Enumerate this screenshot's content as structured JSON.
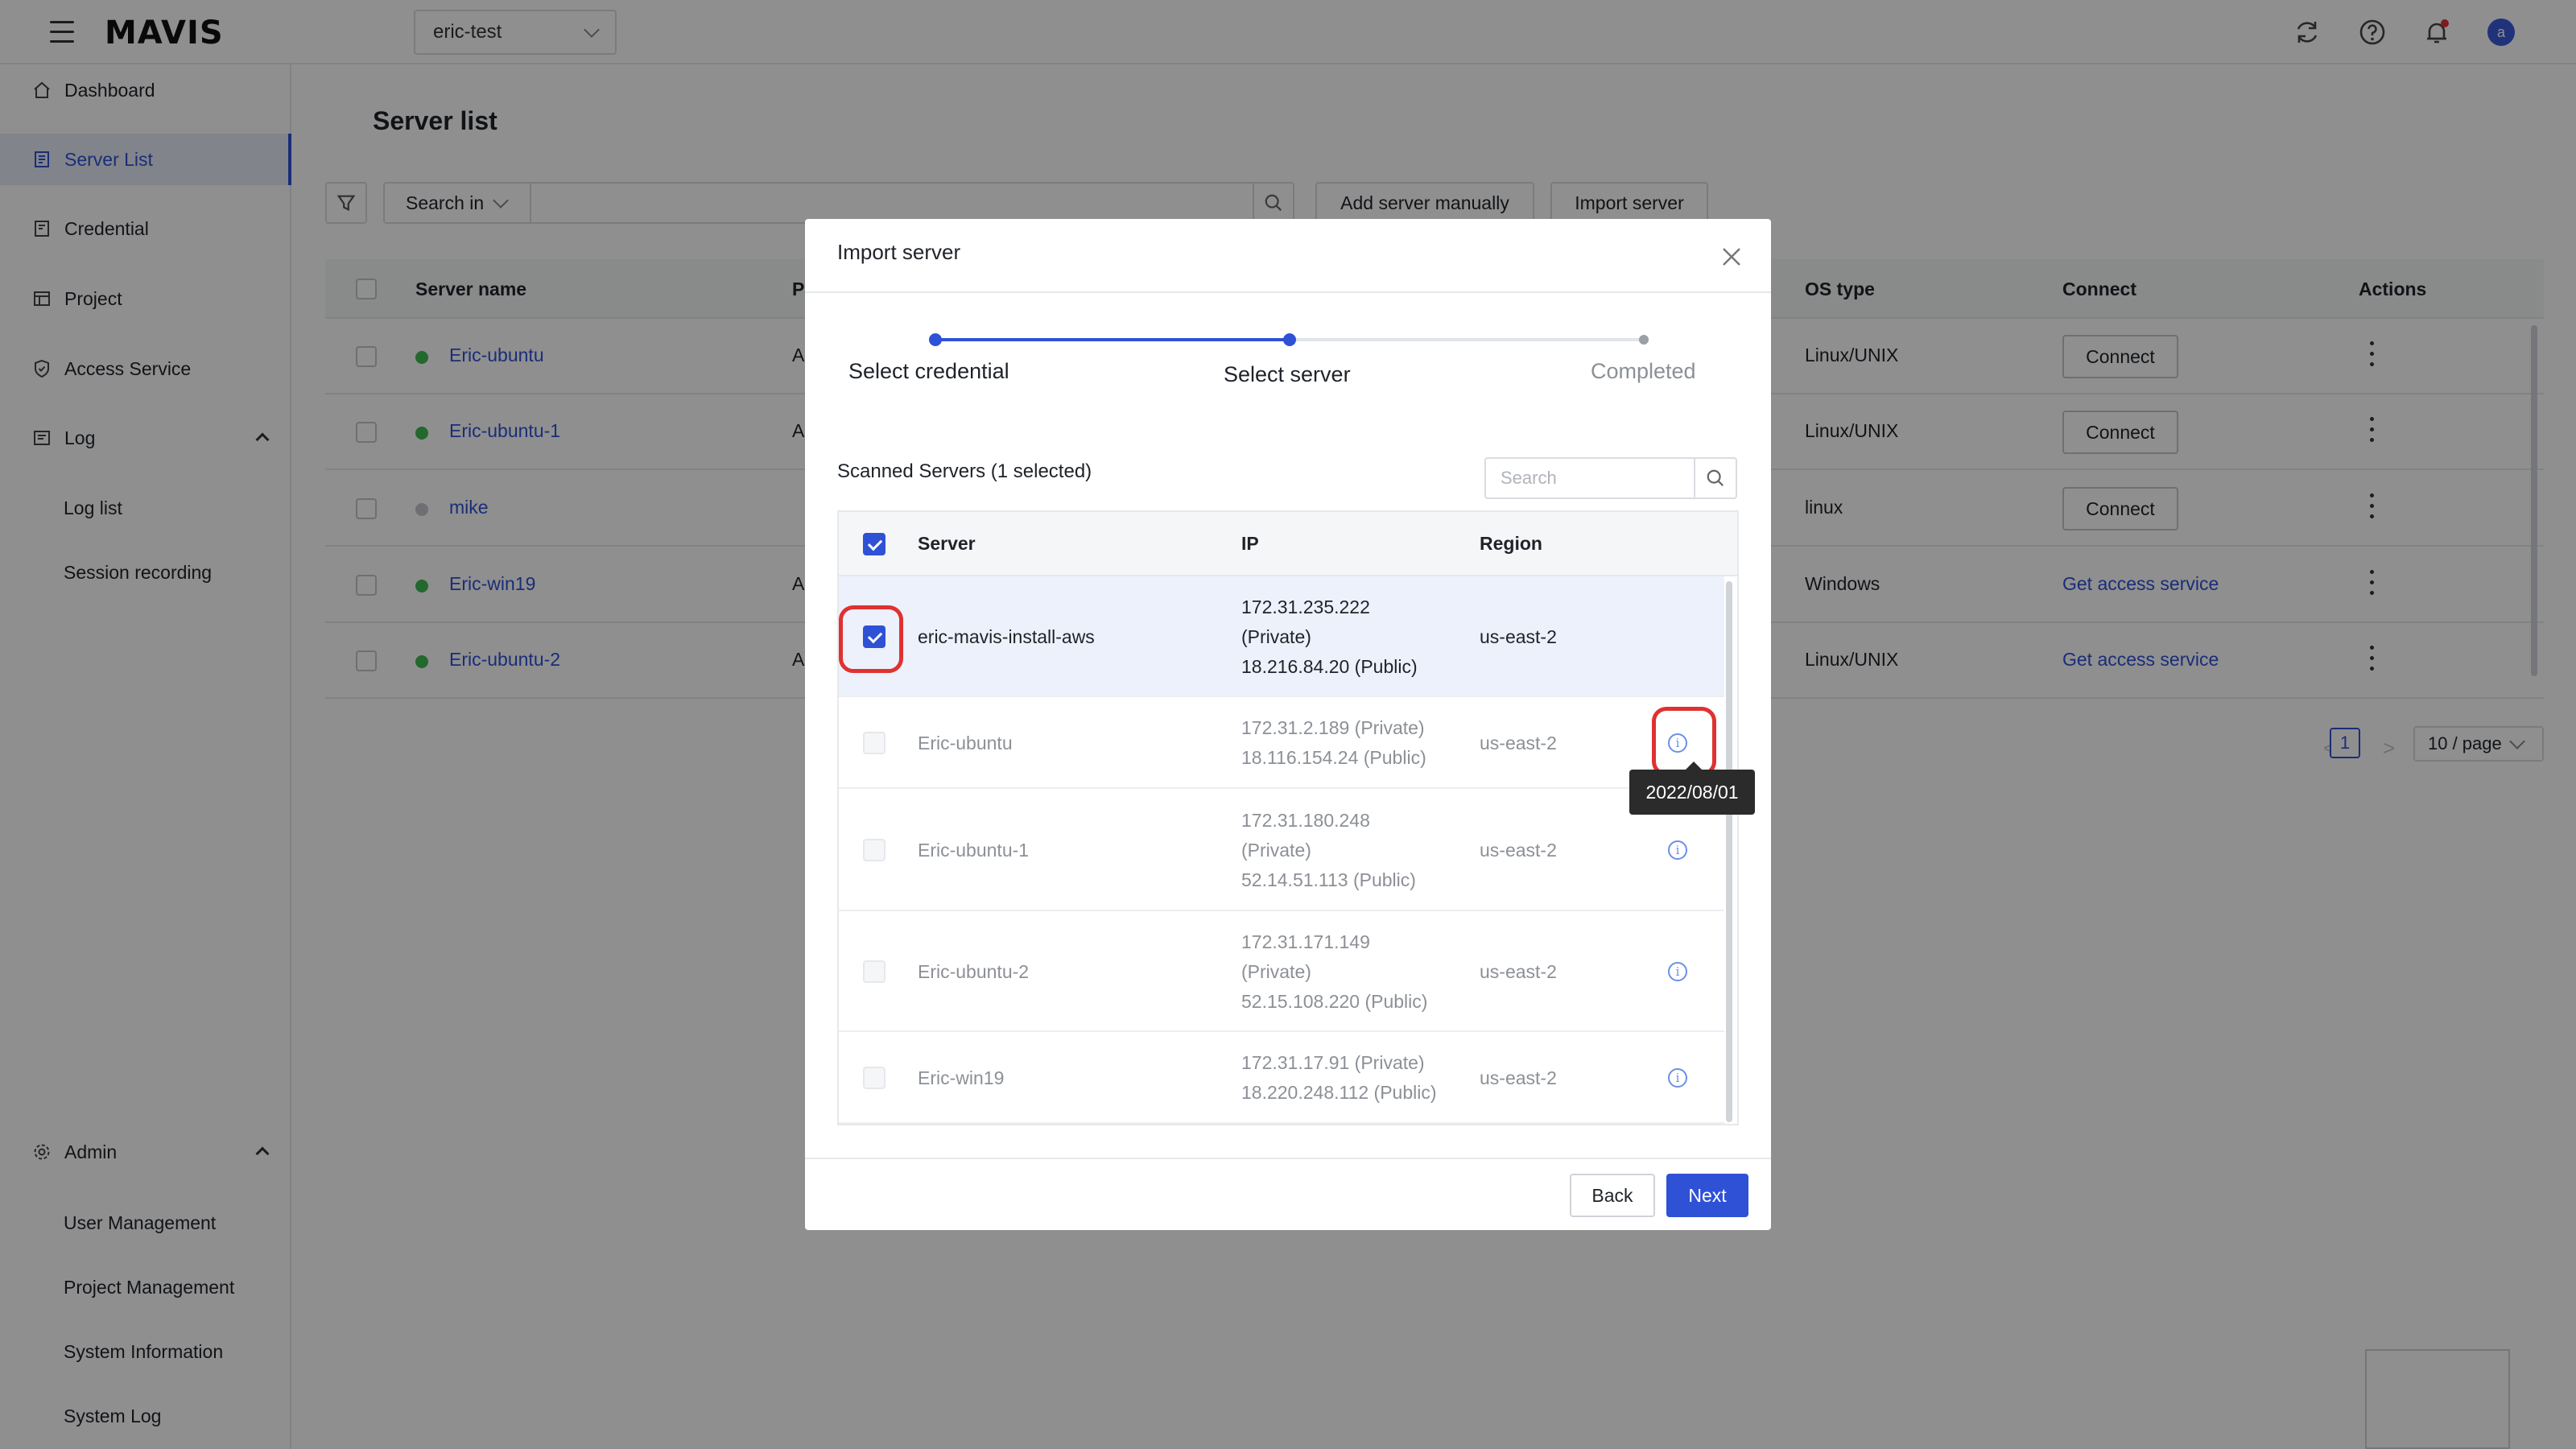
{
  "header": {
    "logo": "MAVIS",
    "project": "eric-test",
    "user_initial": "a"
  },
  "sidebar": {
    "items": [
      {
        "label": "Dashboard",
        "icon": "home-icon"
      },
      {
        "label": "Server List",
        "icon": "server-list-icon",
        "active": true
      },
      {
        "label": "Credential",
        "icon": "credential-icon"
      },
      {
        "label": "Project",
        "icon": "project-icon"
      },
      {
        "label": "Access Service",
        "icon": "shield-icon"
      },
      {
        "label": "Log",
        "icon": "log-icon",
        "expanded": true
      }
    ],
    "log_children": [
      "Log list",
      "Session recording"
    ],
    "admin": {
      "label": "Admin",
      "icon": "gear-icon",
      "expanded": true
    },
    "admin_children": [
      "User Management",
      "Project Management",
      "System Information",
      "System Log"
    ]
  },
  "main": {
    "title": "Server list",
    "search_in": "Search in",
    "add_manual": "Add server manually",
    "import": "Import server",
    "columns": {
      "name": "Server name",
      "p": "P",
      "os": "OS type",
      "connect": "Connect",
      "actions": "Actions"
    },
    "rows": [
      {
        "name": "Eric-ubuntu",
        "p": "A",
        "os": "Linux/UNIX",
        "connect": "Connect",
        "connect_type": "button",
        "status": "online"
      },
      {
        "name": "Eric-ubuntu-1",
        "p": "A",
        "os": "Linux/UNIX",
        "connect": "Connect",
        "connect_type": "button",
        "status": "online"
      },
      {
        "name": "mike",
        "p": "",
        "os": "linux",
        "connect": "Connect",
        "connect_type": "button",
        "status": "offline"
      },
      {
        "name": "Eric-win19",
        "p": "A",
        "os": "Windows",
        "connect": "Get access service",
        "connect_type": "link",
        "status": "online"
      },
      {
        "name": "Eric-ubuntu-2",
        "p": "A",
        "os": "Linux/UNIX",
        "connect": "Get access service",
        "connect_type": "link",
        "status": "online"
      }
    ],
    "pagination": {
      "prev": "<",
      "page": "1",
      "next": ">",
      "page_size": "10 / page"
    }
  },
  "modal": {
    "title": "Import server",
    "steps": [
      "Select credential",
      "Select server",
      "Completed"
    ],
    "scanned_label": "Scanned Servers (1 selected)",
    "search_placeholder": "Search",
    "columns": {
      "server": "Server",
      "ip": "IP",
      "region": "Region"
    },
    "rows": [
      {
        "server": "eric-mavis-install-aws",
        "ip_lines": [
          "172.31.235.222",
          "(Private)",
          "18.216.84.20 (Public)"
        ],
        "region": "us-east-2",
        "selected": true
      },
      {
        "server": "Eric-ubuntu",
        "ip_lines": [
          "172.31.2.189 (Private)",
          "18.116.154.24 (Public)"
        ],
        "region": "us-east-2",
        "selected": false
      },
      {
        "server": "Eric-ubuntu-1",
        "ip_lines": [
          "172.31.180.248",
          "(Private)",
          "52.14.51.113 (Public)"
        ],
        "region": "us-east-2",
        "selected": false
      },
      {
        "server": "Eric-ubuntu-2",
        "ip_lines": [
          "172.31.171.149",
          "(Private)",
          "52.15.108.220 (Public)"
        ],
        "region": "us-east-2",
        "selected": false
      },
      {
        "server": "Eric-win19",
        "ip_lines": [
          "172.31.17.91 (Private)",
          "18.220.248.112 (Public)"
        ],
        "region": "us-east-2",
        "selected": false
      }
    ],
    "tooltip": "2022/08/01",
    "back": "Back",
    "next": "Next"
  },
  "colors": {
    "accent": "#2f51d6",
    "online": "#3fb950",
    "highlight_ring": "#e03131"
  }
}
